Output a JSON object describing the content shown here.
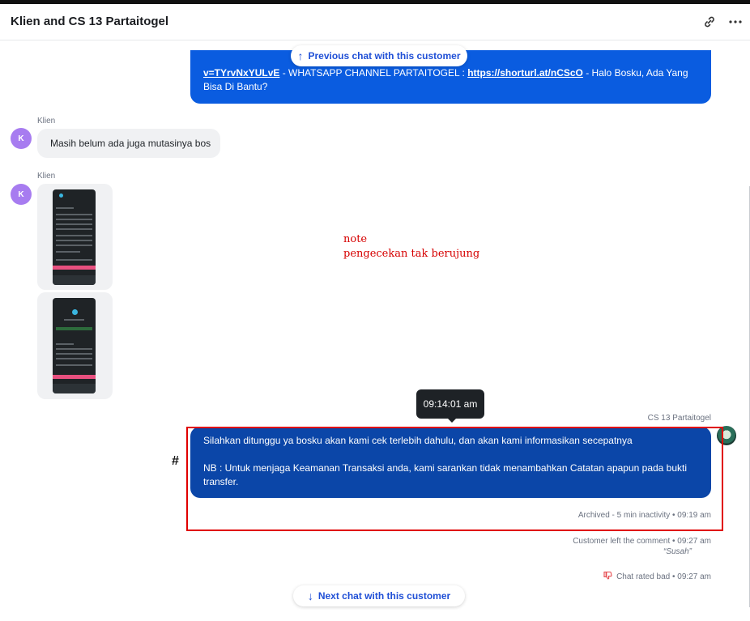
{
  "header": {
    "title": "Klien and CS 13 Partaitogel",
    "link_icon": "link-icon",
    "more_icon": "more-icon"
  },
  "nav": {
    "previous_label": "Previous chat with this customer",
    "next_label": "Next chat with this customer"
  },
  "messages": {
    "agent_top": {
      "link1": "v=TYrvNxYULvE",
      "text1": " - WHATSAPP CHANNEL PARTAITOGEL : ",
      "link2": "https://shorturl.at/nCScO",
      "text2": " - Halo Bosku, Ada Yang Bisa Di Bantu?"
    },
    "customer_1": {
      "sender": "Klien",
      "avatar": "K",
      "text": "Masih belum ada juga mutasinya bos"
    },
    "customer_2": {
      "sender": "Klien",
      "avatar": "K"
    },
    "agent_reply": {
      "sender": "CS 13 Partaitogel",
      "line1": "Silahkan ditunggu ya bosku akan kami cek terlebih dahulu, dan akan kami informasikan secepatnya",
      "line2": "NB : Untuk menjaga Keamanan Transaksi anda, kami sarankan tidak menambahkan Catatan apapun pada bukti transfer."
    }
  },
  "tooltip": {
    "time": "09:14:01 am"
  },
  "annotation": {
    "line1": "note",
    "line2": "pengecekan tak berujung",
    "hash": "#"
  },
  "events": {
    "archived": "Archived - 5 min inactivity • 09:19 am",
    "comment": "Customer left the comment • 09:27 am",
    "comment_text": "“Susah”",
    "rated": "Chat rated bad • 09:27 am"
  },
  "colors": {
    "agent_bubble": "#0a5ce0",
    "agent_bubble_dark": "#0b46a8",
    "avatar": "#a77cf0",
    "nav_link": "#1f4fd6",
    "highlight": "#e00000"
  }
}
